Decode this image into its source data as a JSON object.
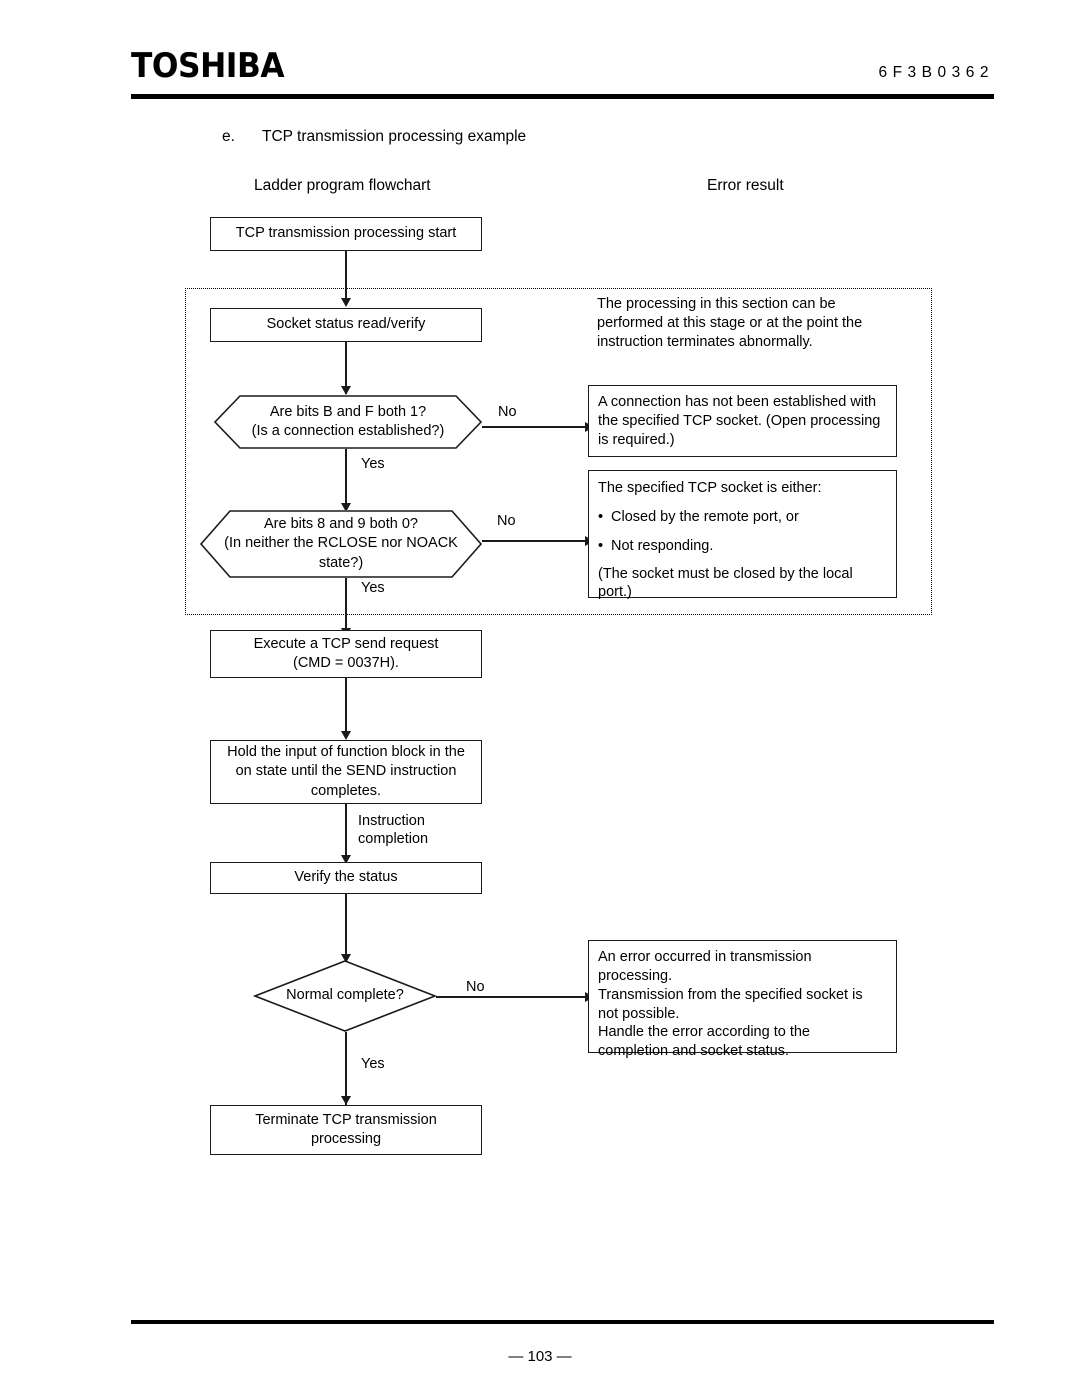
{
  "header": {
    "logo": "TOSHIBA",
    "doc_code": "6F3B0362"
  },
  "footer": {
    "page_number": "— 103 —"
  },
  "section": {
    "letter": "e.",
    "title": "TCP transmission processing example"
  },
  "columns": {
    "left_title": "Ladder program flowchart",
    "right_title": "Error result"
  },
  "flow": {
    "start": "TCP transmission processing start",
    "socket_read": "Socket status read/verify",
    "decision1_line1": "Are bits B and F both 1?",
    "decision1_line2": "(Is a connection established?)",
    "decision2_line1": "Are bits 8 and 9 both 0?",
    "decision2_line2": "(In neither the RCLOSE nor NOACK",
    "decision2_line3": "state?)",
    "send_request_line1": "Execute a TCP send request",
    "send_request_line2": "(CMD = 0037H).",
    "hold_input_line1": "Hold the input of function block in the",
    "hold_input_line2": "on state until the SEND instruction",
    "hold_input_line3": "completes.",
    "instruction_completion_line1": "Instruction",
    "instruction_completion_line2": "completion",
    "verify_status": "Verify the status",
    "normal_complete": "Normal complete?",
    "terminate_line1": "Terminate TCP transmission",
    "terminate_line2": "processing"
  },
  "labels": {
    "yes": "Yes",
    "no": "No"
  },
  "errors": {
    "note_line1": "The processing in this section can be",
    "note_line2": "performed at this stage or at the point the",
    "note_line3": "instruction terminates abnormally.",
    "box1_line1": "A connection has not been established with",
    "box1_line2": "the specified TCP socket. (Open processing",
    "box1_line3": "is required.)",
    "box2_intro": "The specified TCP socket is either:",
    "box2_bullet1": "Closed by the remote port, or",
    "box2_bullet2": "Not responding.",
    "box2_cont_line1": "(The socket must be closed by the local",
    "box2_cont_line2": "port.)",
    "box3_line1": "An error occurred in transmission",
    "box3_line2": "processing.",
    "box3_line3": "Transmission from the specified socket is",
    "box3_line4": "not possible.",
    "box3_line5": "Handle the error according to the",
    "box3_line6": "completion and socket status.",
    "bullet_glyph": "•"
  }
}
